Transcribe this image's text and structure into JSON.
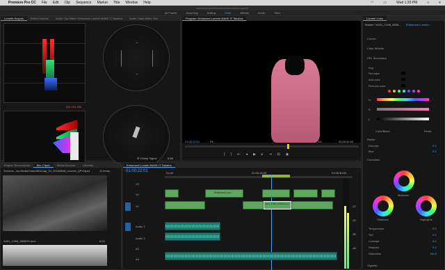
{
  "menu": {
    "items": [
      "Premiere Pro CC",
      "File",
      "Edit",
      "Clip",
      "Sequence",
      "Marker",
      "Title",
      "Window",
      "Help"
    ],
    "time": "Wed 1:30 PM"
  },
  "titlebar": {
    "path": "/Users/ecolore/Movies/Screenshots.prproj *"
  },
  "workspaces": {
    "items": [
      "All Panels",
      "Assembly",
      "Editing",
      "Color",
      "Effects",
      "Audio",
      "Titles"
    ],
    "active": "Color"
  },
  "scopes": {
    "tabs": [
      "Lumetri Scopes",
      "Effect Controls",
      "Audio Clip Mixer: Enhanced Lumetri MAKE IT Takahra",
      "Audio Track Mixer: Enh"
    ],
    "bit_depth": "8 Bit",
    "clamp_signal": "Clamp Signal",
    "rgb_numbers": "231 191 255"
  },
  "program": {
    "tab": "Program: Enhanced Lumetri MAKE IT Takahra",
    "timecode": "01:00:22:01",
    "fit": "Fit",
    "quality": "1/4",
    "duration": "00:00:41:00"
  },
  "lumetri": {
    "title": "Lumetri Color",
    "master": "Master * A001_C068_0808...",
    "clip": "Enhanced Lumetri...",
    "sections": {
      "curves": "Curves",
      "color_wheels": "Color Wheels",
      "hsl_secondary": "HSL Secondary",
      "key": "Key",
      "set_color": "Set color",
      "add_color": "Add color",
      "remove_color": "Remove color",
      "color_black": "Color/Black",
      "reset": "Reset",
      "refine": "Refine",
      "denoise": "Denoise",
      "blur": "Blur",
      "correction": "Correction",
      "midtones": "Midtones",
      "shadows": "Shadows",
      "highlights": "Highlights",
      "temperature": "Temperature",
      "tint": "Tint",
      "contrast": "Contrast",
      "sharpen": "Sharpen",
      "saturation": "Saturation",
      "vignette": "Vignette"
    },
    "values": {
      "denoise": "0.0",
      "blur": "0.0",
      "temperature": "0.0",
      "tint": "0.0",
      "contrast": "0.0",
      "sharpen": "0.0",
      "saturation": "100.0"
    },
    "labels_hsl": [
      "H",
      "S",
      "L"
    ]
  },
  "project": {
    "tabs": [
      "Project: Screenshots",
      "Bin: Clips1",
      "Media Browser",
      "Libraries"
    ],
    "path": "Screens...ins Media\\Video\\BD\\Clap_01_20150808_convert_QP\\Clips1",
    "count": "11 Items",
    "clip1_name": "A001_C068_0808XH.mov",
    "clip1_dur": "6:03"
  },
  "timeline": {
    "tab": "Enhanced Lumetri MAKE IT Takahra",
    "timecode": "01:00:22:01",
    "ruler": [
      "01:00",
      "01:00:15:00",
      "01:00:30:00"
    ],
    "tracks": [
      {
        "name": "V3"
      },
      {
        "name": "V2"
      },
      {
        "name": "V1"
      },
      {
        "name": "Audio 1"
      },
      {
        "name": "Audio 2"
      },
      {
        "name": "A3"
      },
      {
        "name": "A4"
      }
    ],
    "clips": [
      "Enhanced Lum...",
      "A001_C068_0808XH.mov",
      "A001_C068..."
    ],
    "counter": "-18",
    "db": [
      "-12",
      "-24",
      "-36",
      "-48"
    ]
  },
  "colors": {
    "accent": "#4aa3ff",
    "audio": "#1f7a6f",
    "video": "#5fa65f",
    "playhead": "#4aa3ff"
  }
}
